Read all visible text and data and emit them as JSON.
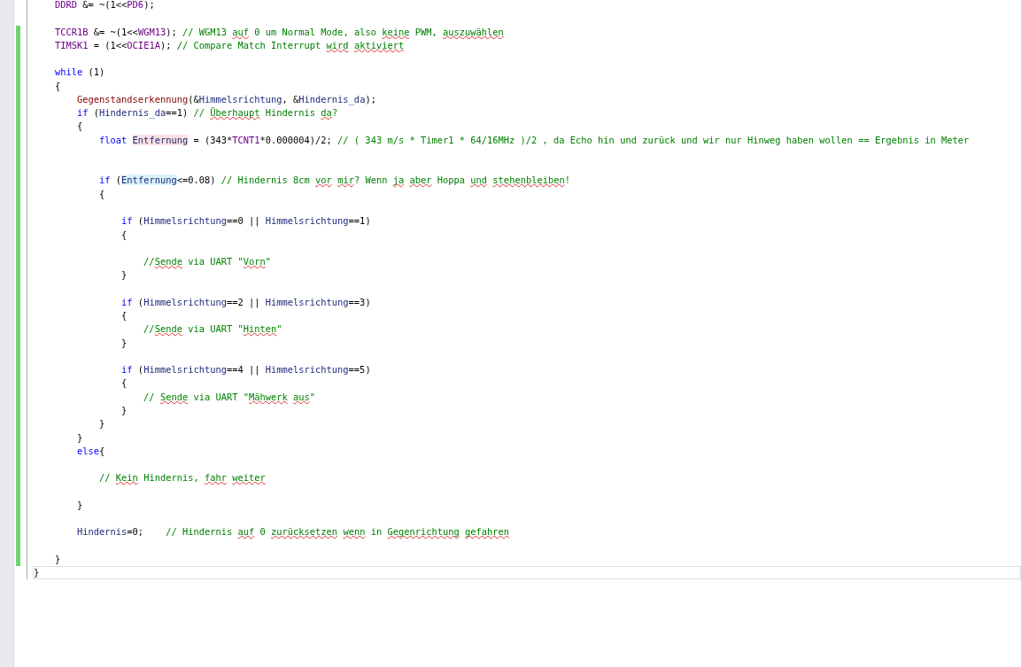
{
  "lines": [
    {
      "changed": false,
      "current": false,
      "tokens": [
        {
          "kind": "macro",
          "text": "    DDRD"
        },
        {
          "kind": "plain",
          "text": " &= ~(1<<"
        },
        {
          "kind": "macro",
          "text": "PD6"
        },
        {
          "kind": "plain",
          "text": ");"
        }
      ]
    },
    {
      "changed": false,
      "current": false
    },
    {
      "changed": true,
      "current": false,
      "tokens": [
        {
          "kind": "macro",
          "text": "    TCCR1B"
        },
        {
          "kind": "plain",
          "text": " &= ~(1<<"
        },
        {
          "kind": "macro",
          "text": "WGM13"
        },
        {
          "kind": "plain",
          "text": "); "
        },
        {
          "kind": "comment",
          "text": "// WGM13 "
        },
        {
          "kind": "misspelled",
          "text": "auf"
        },
        {
          "kind": "comment",
          "text": " 0 um Normal Mode, also "
        },
        {
          "kind": "misspelled",
          "text": "keine"
        },
        {
          "kind": "comment",
          "text": " PWM, "
        },
        {
          "kind": "misspelled",
          "text": "auszuwählen"
        }
      ]
    },
    {
      "changed": true,
      "current": false,
      "tokens": [
        {
          "kind": "macro",
          "text": "    TIMSK1"
        },
        {
          "kind": "plain",
          "text": " = (1<<"
        },
        {
          "kind": "macro",
          "text": "OCIE1A"
        },
        {
          "kind": "plain",
          "text": "); "
        },
        {
          "kind": "comment",
          "text": "// Compare Match Interrupt "
        },
        {
          "kind": "misspelled",
          "text": "wird aktiviert"
        }
      ]
    },
    {
      "changed": true,
      "current": false
    },
    {
      "changed": true,
      "current": false,
      "tokens": [
        {
          "kind": "keyword",
          "text": "    while"
        },
        {
          "kind": "plain",
          "text": " (1)"
        }
      ]
    },
    {
      "changed": true,
      "current": false,
      "tokens": [
        {
          "kind": "plain",
          "text": "    {"
        }
      ]
    },
    {
      "changed": true,
      "current": false,
      "tokens": [
        {
          "kind": "function",
          "text": "        Gegenstandserkennung"
        },
        {
          "kind": "plain",
          "text": "(&"
        },
        {
          "kind": "variable",
          "text": "Himmelsrichtung"
        },
        {
          "kind": "plain",
          "text": ", &"
        },
        {
          "kind": "variable",
          "text": "Hindernis_da"
        },
        {
          "kind": "plain",
          "text": ");"
        }
      ]
    },
    {
      "changed": true,
      "current": false,
      "tokens": [
        {
          "kind": "keyword",
          "text": "        if"
        },
        {
          "kind": "plain",
          "text": " ("
        },
        {
          "kind": "variable",
          "text": "Hindernis_da"
        },
        {
          "kind": "plain",
          "text": "==1) "
        },
        {
          "kind": "comment",
          "text": "// "
        },
        {
          "kind": "misspelled",
          "text": "Überhaupt"
        },
        {
          "kind": "comment",
          "text": " Hindernis "
        },
        {
          "kind": "misspelled",
          "text": "da"
        },
        {
          "kind": "comment",
          "text": "?"
        }
      ]
    },
    {
      "changed": true,
      "current": false,
      "tokens": [
        {
          "kind": "plain",
          "text": "        {"
        }
      ]
    },
    {
      "changed": true,
      "current": false,
      "tokens": [
        {
          "kind": "keyword",
          "text": "            float "
        },
        {
          "kind": "declaration",
          "text": "Entfernung"
        },
        {
          "kind": "plain",
          "text": " = (343*"
        },
        {
          "kind": "macro",
          "text": "TCNT1"
        },
        {
          "kind": "plain",
          "text": "*0.000004)/2; "
        },
        {
          "kind": "comment",
          "text": "// ( 343 m/s * Timer1 * 64/16MHz )/2 , da Echo hin und zurück und wir nur Hinweg haben wollen == Ergebnis in Meter"
        }
      ]
    },
    {
      "changed": true,
      "current": false
    },
    {
      "changed": true,
      "current": false
    },
    {
      "changed": true,
      "current": false,
      "tokens": [
        {
          "kind": "keyword",
          "text": "            if"
        },
        {
          "kind": "plain",
          "text": " ("
        },
        {
          "kind": "reference",
          "text": "Entfernung"
        },
        {
          "kind": "plain",
          "text": "<=0.08) "
        },
        {
          "kind": "comment",
          "text": "// Hindernis 8cm "
        },
        {
          "kind": "misspelled",
          "text": "vor mir"
        },
        {
          "kind": "comment",
          "text": "? Wenn "
        },
        {
          "kind": "misspelled",
          "text": "ja aber"
        },
        {
          "kind": "comment",
          "text": " Hoppa "
        },
        {
          "kind": "misspelled",
          "text": "und stehenbleiben"
        },
        {
          "kind": "comment",
          "text": "!"
        }
      ]
    },
    {
      "changed": true,
      "current": false,
      "tokens": [
        {
          "kind": "plain",
          "text": "            {"
        }
      ]
    },
    {
      "changed": true,
      "current": false
    },
    {
      "changed": true,
      "current": false,
      "tokens": [
        {
          "kind": "keyword",
          "text": "                if"
        },
        {
          "kind": "plain",
          "text": " ("
        },
        {
          "kind": "variable",
          "text": "Himmelsrichtung"
        },
        {
          "kind": "plain",
          "text": "==0 || "
        },
        {
          "kind": "variable",
          "text": "Himmelsrichtung"
        },
        {
          "kind": "plain",
          "text": "==1)"
        }
      ]
    },
    {
      "changed": true,
      "current": false,
      "tokens": [
        {
          "kind": "plain",
          "text": "                {"
        }
      ]
    },
    {
      "changed": true,
      "current": false
    },
    {
      "changed": true,
      "current": false,
      "tokens": [
        {
          "kind": "comment",
          "text": "                    //"
        },
        {
          "kind": "misspelled",
          "text": "Sende"
        },
        {
          "kind": "comment",
          "text": " via UART \""
        },
        {
          "kind": "misspelled",
          "text": "Vorn"
        },
        {
          "kind": "comment",
          "text": "\""
        }
      ]
    },
    {
      "changed": true,
      "current": false,
      "tokens": [
        {
          "kind": "plain",
          "text": "                }"
        }
      ]
    },
    {
      "changed": true,
      "current": false
    },
    {
      "changed": true,
      "current": false,
      "tokens": [
        {
          "kind": "keyword",
          "text": "                if"
        },
        {
          "kind": "plain",
          "text": " ("
        },
        {
          "kind": "variable",
          "text": "Himmelsrichtung"
        },
        {
          "kind": "plain",
          "text": "==2 || "
        },
        {
          "kind": "variable",
          "text": "Himmelsrichtung"
        },
        {
          "kind": "plain",
          "text": "==3)"
        }
      ]
    },
    {
      "changed": true,
      "current": false,
      "tokens": [
        {
          "kind": "plain",
          "text": "                {"
        }
      ]
    },
    {
      "changed": true,
      "current": false,
      "tokens": [
        {
          "kind": "comment",
          "text": "                    //"
        },
        {
          "kind": "misspelled",
          "text": "Sende"
        },
        {
          "kind": "comment",
          "text": " via UART \""
        },
        {
          "kind": "misspelled",
          "text": "Hinten"
        },
        {
          "kind": "comment",
          "text": "\""
        }
      ]
    },
    {
      "changed": true,
      "current": false,
      "tokens": [
        {
          "kind": "plain",
          "text": "                }"
        }
      ]
    },
    {
      "changed": true,
      "current": false
    },
    {
      "changed": true,
      "current": false,
      "tokens": [
        {
          "kind": "keyword",
          "text": "                if"
        },
        {
          "kind": "plain",
          "text": " ("
        },
        {
          "kind": "variable",
          "text": "Himmelsrichtung"
        },
        {
          "kind": "plain",
          "text": "==4 || "
        },
        {
          "kind": "variable",
          "text": "Himmelsrichtung"
        },
        {
          "kind": "plain",
          "text": "==5)"
        }
      ]
    },
    {
      "changed": true,
      "current": false,
      "tokens": [
        {
          "kind": "plain",
          "text": "                {"
        }
      ]
    },
    {
      "changed": true,
      "current": false,
      "tokens": [
        {
          "kind": "comment",
          "text": "                    // "
        },
        {
          "kind": "misspelled",
          "text": "Sende"
        },
        {
          "kind": "comment",
          "text": " via UART \""
        },
        {
          "kind": "misspelled",
          "text": "Mähwerk aus"
        },
        {
          "kind": "comment",
          "text": "\""
        }
      ]
    },
    {
      "changed": true,
      "current": false,
      "tokens": [
        {
          "kind": "plain",
          "text": "                }"
        }
      ]
    },
    {
      "changed": true,
      "current": false,
      "tokens": [
        {
          "kind": "plain",
          "text": "            }"
        }
      ]
    },
    {
      "changed": true,
      "current": false,
      "tokens": [
        {
          "kind": "plain",
          "text": "        }"
        }
      ]
    },
    {
      "changed": true,
      "current": false,
      "tokens": [
        {
          "kind": "keyword",
          "text": "        else"
        },
        {
          "kind": "plain",
          "text": "{"
        }
      ]
    },
    {
      "changed": true,
      "current": false
    },
    {
      "changed": true,
      "current": false,
      "tokens": [
        {
          "kind": "comment",
          "text": "            // "
        },
        {
          "kind": "misspelled",
          "text": "Kein"
        },
        {
          "kind": "comment",
          "text": " Hindernis, "
        },
        {
          "kind": "misspelled",
          "text": "fahr weiter"
        }
      ]
    },
    {
      "changed": true,
      "current": false
    },
    {
      "changed": true,
      "current": false,
      "tokens": [
        {
          "kind": "plain",
          "text": "        }"
        }
      ]
    },
    {
      "changed": true,
      "current": false
    },
    {
      "changed": true,
      "current": false,
      "tokens": [
        {
          "kind": "variable",
          "text": "        Hindernis"
        },
        {
          "kind": "plain",
          "text": "=0;    "
        },
        {
          "kind": "comment",
          "text": "// Hindernis "
        },
        {
          "kind": "misspelled",
          "text": "auf"
        },
        {
          "kind": "comment",
          "text": " 0 "
        },
        {
          "kind": "misspelled",
          "text": "zurücksetzen wenn"
        },
        {
          "kind": "comment",
          "text": " in "
        },
        {
          "kind": "misspelled",
          "text": "Gegenrichtung gefahren"
        }
      ]
    },
    {
      "changed": true,
      "current": false
    },
    {
      "changed": true,
      "current": false,
      "tokens": [
        {
          "kind": "plain",
          "text": "    }"
        }
      ]
    },
    {
      "changed": false,
      "current": true,
      "tokens": [
        {
          "kind": "plain",
          "text": "}"
        }
      ]
    }
  ]
}
